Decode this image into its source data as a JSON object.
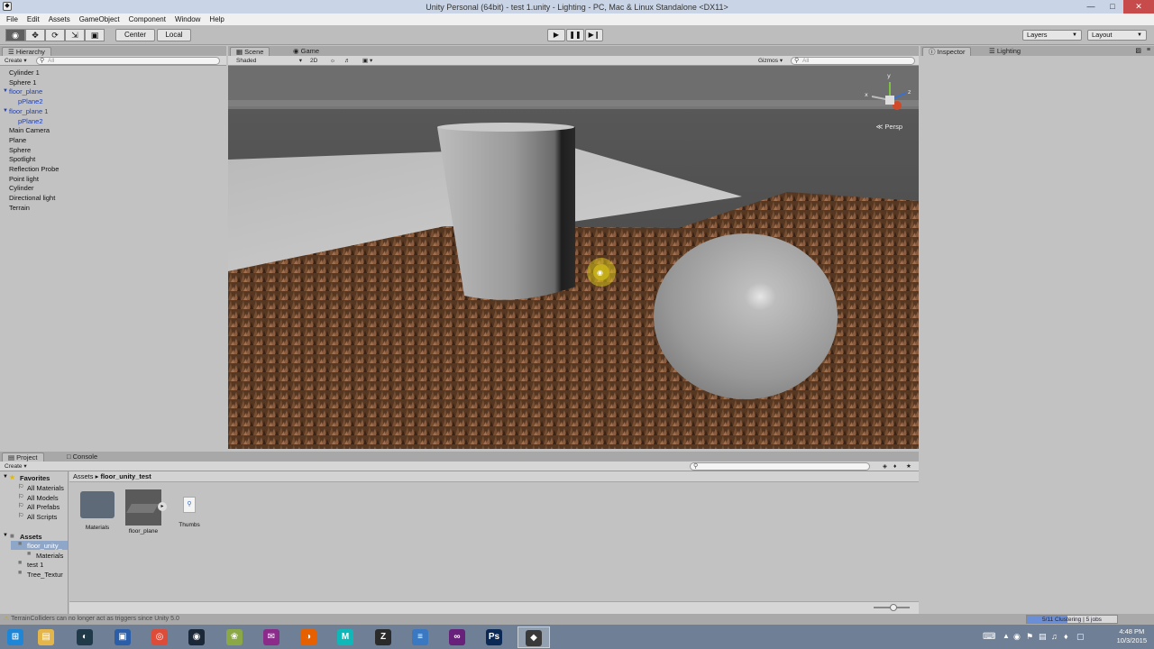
{
  "window": {
    "title": "Unity Personal (64bit) - test 1.unity - Lighting - PC, Mac & Linux Standalone <DX11>"
  },
  "menu": [
    "File",
    "Edit",
    "Assets",
    "GameObject",
    "Component",
    "Window",
    "Help"
  ],
  "toolbar": {
    "pivot": "Center",
    "space": "Local",
    "layers": "Layers",
    "layout": "Layout"
  },
  "hierarchy": {
    "tab": "Hierarchy",
    "create": "Create",
    "search_placeholder": "All",
    "items": [
      {
        "label": "Cylinder 1",
        "blue": false,
        "child": false,
        "parent": false
      },
      {
        "label": "Sphere 1",
        "blue": false,
        "child": false,
        "parent": false
      },
      {
        "label": "floor_plane",
        "blue": true,
        "child": false,
        "parent": true
      },
      {
        "label": "pPlane2",
        "blue": true,
        "child": true,
        "parent": false
      },
      {
        "label": "floor_plane 1",
        "blue": true,
        "child": false,
        "parent": true
      },
      {
        "label": "pPlane2",
        "blue": true,
        "child": true,
        "parent": false
      },
      {
        "label": "Main Camera",
        "blue": false,
        "child": false,
        "parent": false
      },
      {
        "label": "Plane",
        "blue": false,
        "child": false,
        "parent": false
      },
      {
        "label": "Sphere",
        "blue": false,
        "child": false,
        "parent": false
      },
      {
        "label": "Spotlight",
        "blue": false,
        "child": false,
        "parent": false
      },
      {
        "label": "Reflection Probe",
        "blue": false,
        "child": false,
        "parent": false
      },
      {
        "label": "Point light",
        "blue": false,
        "child": false,
        "parent": false
      },
      {
        "label": "Cylinder",
        "blue": false,
        "child": false,
        "parent": false
      },
      {
        "label": "Directional light",
        "blue": false,
        "child": false,
        "parent": false
      },
      {
        "label": "Terrain",
        "blue": false,
        "child": false,
        "parent": false
      }
    ]
  },
  "scene": {
    "tab_scene": "Scene",
    "tab_game": "Game",
    "shading": "Shaded",
    "mode_2d": "2D",
    "gizmos": "Gizmos",
    "search_placeholder": "All",
    "persp": "Persp",
    "gizmo_axes": {
      "x": "x",
      "y": "y",
      "z": "z"
    }
  },
  "inspector": {
    "tab_inspector": "Inspector",
    "tab_lighting": "Lighting"
  },
  "project": {
    "tab_project": "Project",
    "tab_console": "Console",
    "create": "Create",
    "favorites_header": "Favorites",
    "favorites": [
      "All Materials",
      "All Models",
      "All Prefabs",
      "All Scripts"
    ],
    "assets_header": "Assets",
    "tree": [
      {
        "label": "floor_unity_",
        "selected": true
      },
      {
        "label": "Materials",
        "selected": false
      },
      {
        "label": "test 1",
        "selected": false
      },
      {
        "label": "Tree_Textur",
        "selected": false
      }
    ],
    "breadcrumb_root": "Assets",
    "breadcrumb_current": "floor_unity_test",
    "assets": [
      "Materials",
      "floor_plane",
      "Thumbs"
    ]
  },
  "status": {
    "message": "TerrainColliders can no longer act as triggers since Unity 5.0",
    "progress_text": "5/11 Clustering | 5 jobs",
    "progress_fraction": 0.45
  },
  "taskbar": {
    "apps": [
      "Windows",
      "File Explorer",
      "DAZ",
      "Remote Desktop",
      "Chrome",
      "Steam",
      "Garden",
      "Mail",
      "Firefox",
      "Maya",
      "Zbrush",
      "Notes",
      "Visual Studio",
      "Photoshop",
      "Unity"
    ],
    "time": "4:48 PM",
    "date": "10/3/2015"
  },
  "colors": {
    "unity_bg": "#c2c2c2",
    "hierarchy_blue": "#1f3fb2",
    "taskbar": "#6f8096",
    "progress": "#6b8fd6"
  }
}
